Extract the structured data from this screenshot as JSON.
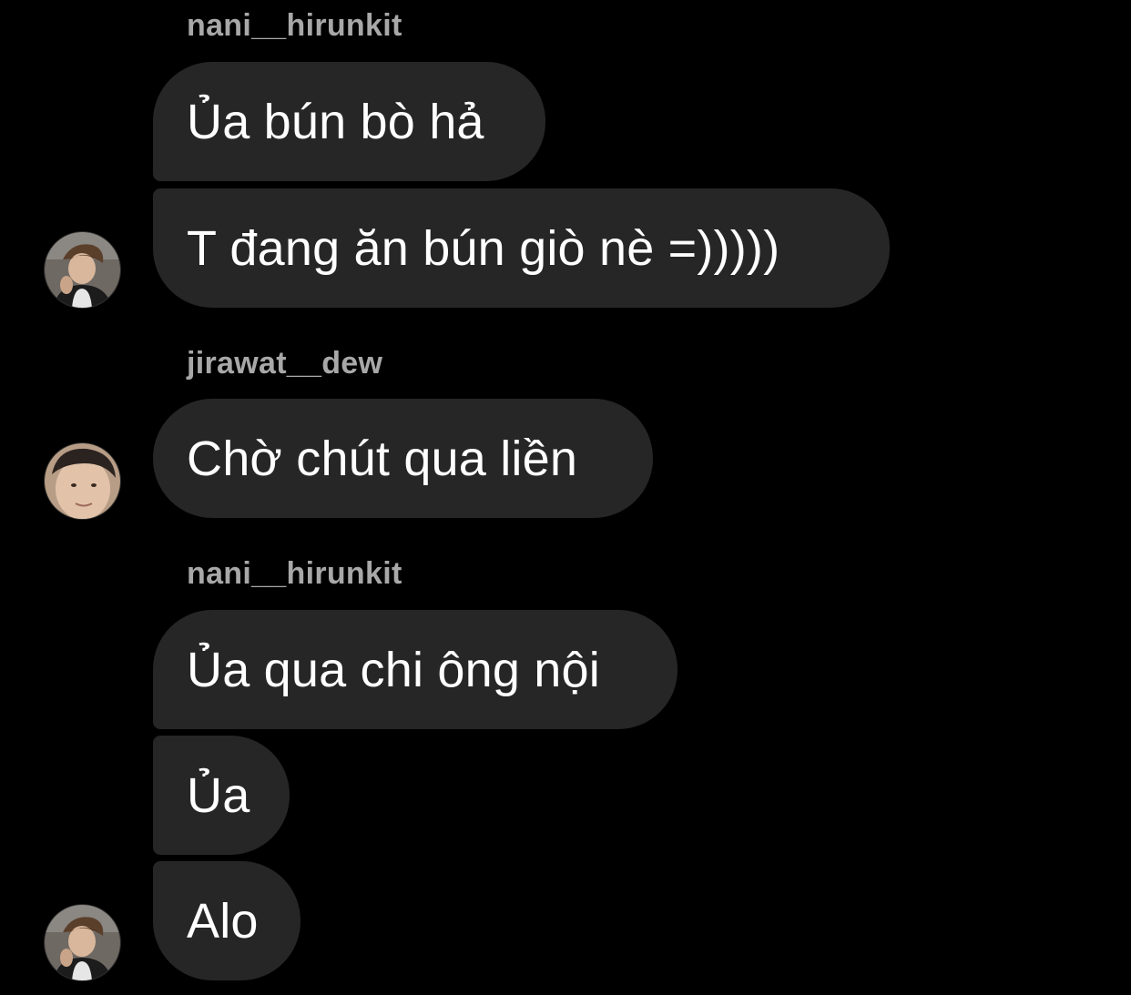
{
  "conversation": {
    "groups": [
      {
        "sender": "nani__hirunkit",
        "messages": [
          "Ủa bún bò hả",
          "T đang ăn bún giò nè =)))))"
        ]
      },
      {
        "sender": "jirawat__dew",
        "messages": [
          "Chờ chút qua liền"
        ]
      },
      {
        "sender": "nani__hirunkit",
        "messages": [
          "Ủa qua chi ông nội",
          "Ủa",
          "Alo"
        ]
      }
    ]
  },
  "colors": {
    "background": "#000000",
    "bubble": "#262626",
    "sender_name": "#a8a8a8",
    "text": "#ffffff"
  }
}
